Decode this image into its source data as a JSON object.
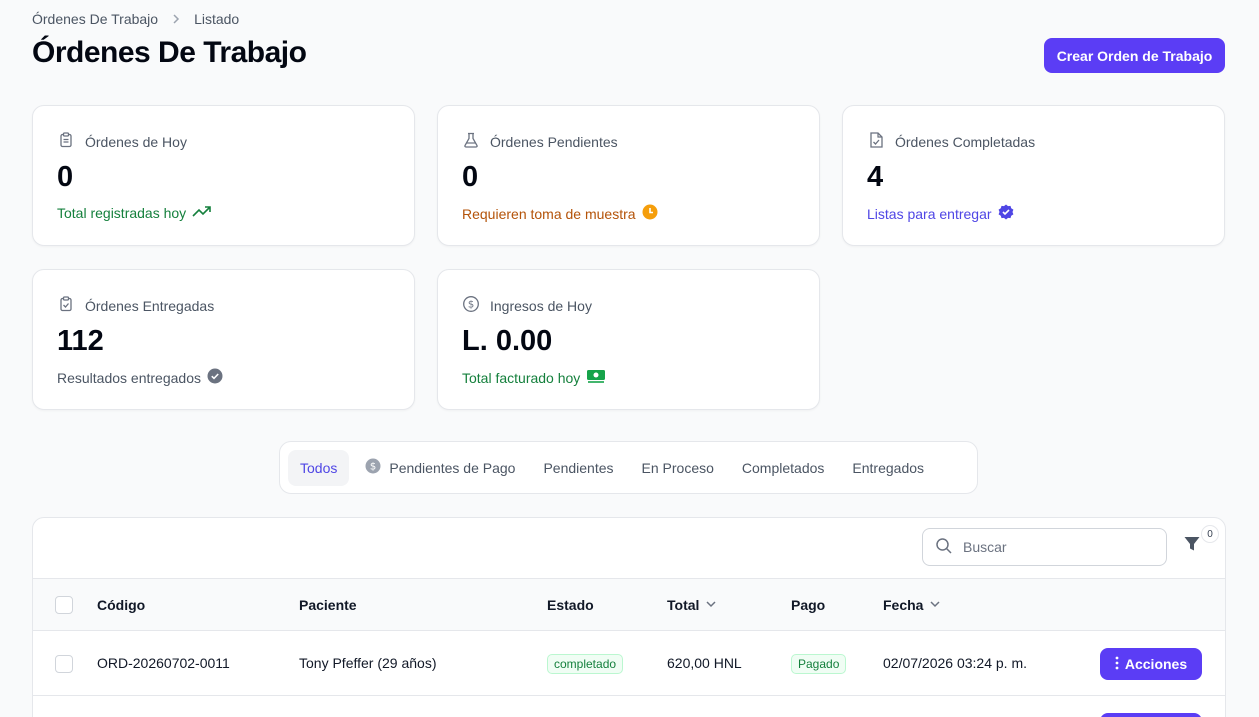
{
  "breadcrumb": {
    "parent": "Órdenes De Trabajo",
    "current": "Listado"
  },
  "header": {
    "title": "Órdenes De Trabajo",
    "create_button": "Crear Orden de Trabajo"
  },
  "stats": [
    {
      "label": "Órdenes de Hoy",
      "value": "0",
      "description": "Total registradas hoy",
      "icon": "clipboard-icon",
      "color": "#15803d"
    },
    {
      "label": "Órdenes Pendientes",
      "value": "0",
      "description": "Requieren toma de muestra",
      "icon": "beaker-icon",
      "color": "#b45309"
    },
    {
      "label": "Órdenes Completadas",
      "value": "4",
      "description": "Listas para entregar",
      "icon": "document-check-icon",
      "color": "#4f46e5"
    },
    {
      "label": "Órdenes Entregadas",
      "value": "112",
      "description": "Resultados entregados",
      "icon": "clipboard-check-icon",
      "color": "#4b5563"
    },
    {
      "label": "Ingresos de Hoy",
      "value": "L. 0.00",
      "description": "Total facturado hoy",
      "icon": "currency-icon",
      "color": "#15803d"
    }
  ],
  "tabs": [
    "Todos",
    "Pendientes de Pago",
    "Pendientes",
    "En Proceso",
    "Completados",
    "Entregados"
  ],
  "table": {
    "search_placeholder": "Buscar",
    "filter_count": "0",
    "columns": [
      "Código",
      "Paciente",
      "Estado",
      "Total",
      "Pago",
      "Fecha"
    ],
    "rows": [
      {
        "codigo": "ORD-20260702-0011",
        "paciente": "Tony Pfeffer (29 años)",
        "estado": "completado",
        "total": "620,00 HNL",
        "pago": "Pagado",
        "fecha": "02/07/2026 03:24 p. m.",
        "accion": "Acciones"
      }
    ]
  },
  "colors": {
    "accent": "#5b3df5",
    "success": "#15803d",
    "warning": "#b45309",
    "info": "#4f46e5"
  }
}
